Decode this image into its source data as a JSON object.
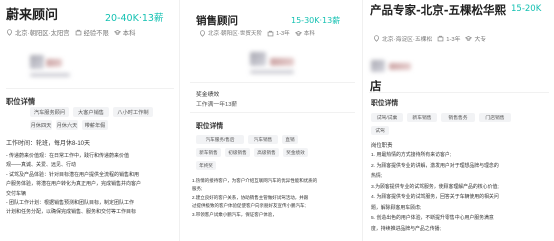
{
  "accent_color": "#15c1b2",
  "job1": {
    "title": "蔚来顾问",
    "salary": "20-40K·13薪",
    "location": "北京·朝阳区·太阳宫",
    "experience": "经验不限",
    "education": "本科",
    "section_title": "职位详情",
    "tags": [
      "汽车服务顾问",
      "大客户销售",
      "八小时工作制",
      "月休四天",
      "月休六天",
      "带薪年假"
    ],
    "work_time": "工作时间：轮班，每月休8-10天",
    "body": "- 传递蔚来价值观：在日常工作中，践行和传递蔚来价值\n观——真诚、关爱、远见、行动\n- 试驾及产品体验：针对目标潜在用户提供全流程的销售和用\n户服务体验，将潜在用户转化为真正用户，完成销售并向客户\n交付车辆\n- 团队工作计划：根据销售预测和团队目标，制定团队工作\n计划和任务分配，以确保完成销售、服务和交付等工作目标"
  },
  "job2": {
    "title": "销售顾问",
    "salary": "15-30K·13薪",
    "location": "北京·朝阳区·世贸天阶",
    "experience": "1-3年",
    "education": "本科",
    "bonus_label": "奖金绩效",
    "bonus_value": "工作满一年13薪",
    "section_title": "职位详情",
    "tags_row1": [
      "汽车服务/售后",
      "汽车销售",
      "直销"
    ],
    "tags_row2": [
      "新车销售",
      "初级销售",
      "高级销售",
      "奖金绩效"
    ],
    "tags_row3": [
      "年终奖"
    ],
    "body": "1.热情的接待客户，为客户介绍互联网汽车的优异性能和优质的\n服务;\n2.建立良好的客户关系，协助销售主管做好试驾活动，并跟\n过提供极致的客户体验促使客户向亲朋好友宣传小鹏汽车;\n3.带领客户试乘小鹏汽车，保证客户体验，"
  },
  "job3": {
    "title_line1": "产品专家-北京-五棵松华熙",
    "title_line2": "店",
    "salary": "15-20K",
    "location": "北京·海淀区·五棵松",
    "experience": "1-3年",
    "education": "大专",
    "section_title": "职位详情",
    "tags_row1": [
      "试驾/试乘",
      "新车销售",
      "销售售务",
      "门店销售"
    ],
    "tags_row2": [
      "试驾"
    ],
    "heading": "岗位职责",
    "body": "1. 用最热情的方式接待所有来访客户;\n2. 为顾客提供专业的讲解，激发用户对于理想品牌与理念的\n热情;\n3.为顾客提供专业的试驾服务，使顾客理解产品的核心价值;\n4. 为顾客提供专业的试驾服务，回答关于车辆使用的相关问\n题，解除顾客用车顾虑;\n5. 创造出色的用户体验，不断提升零售中心用户服务满意\n度，持续推进品牌与产品之传播;"
  }
}
